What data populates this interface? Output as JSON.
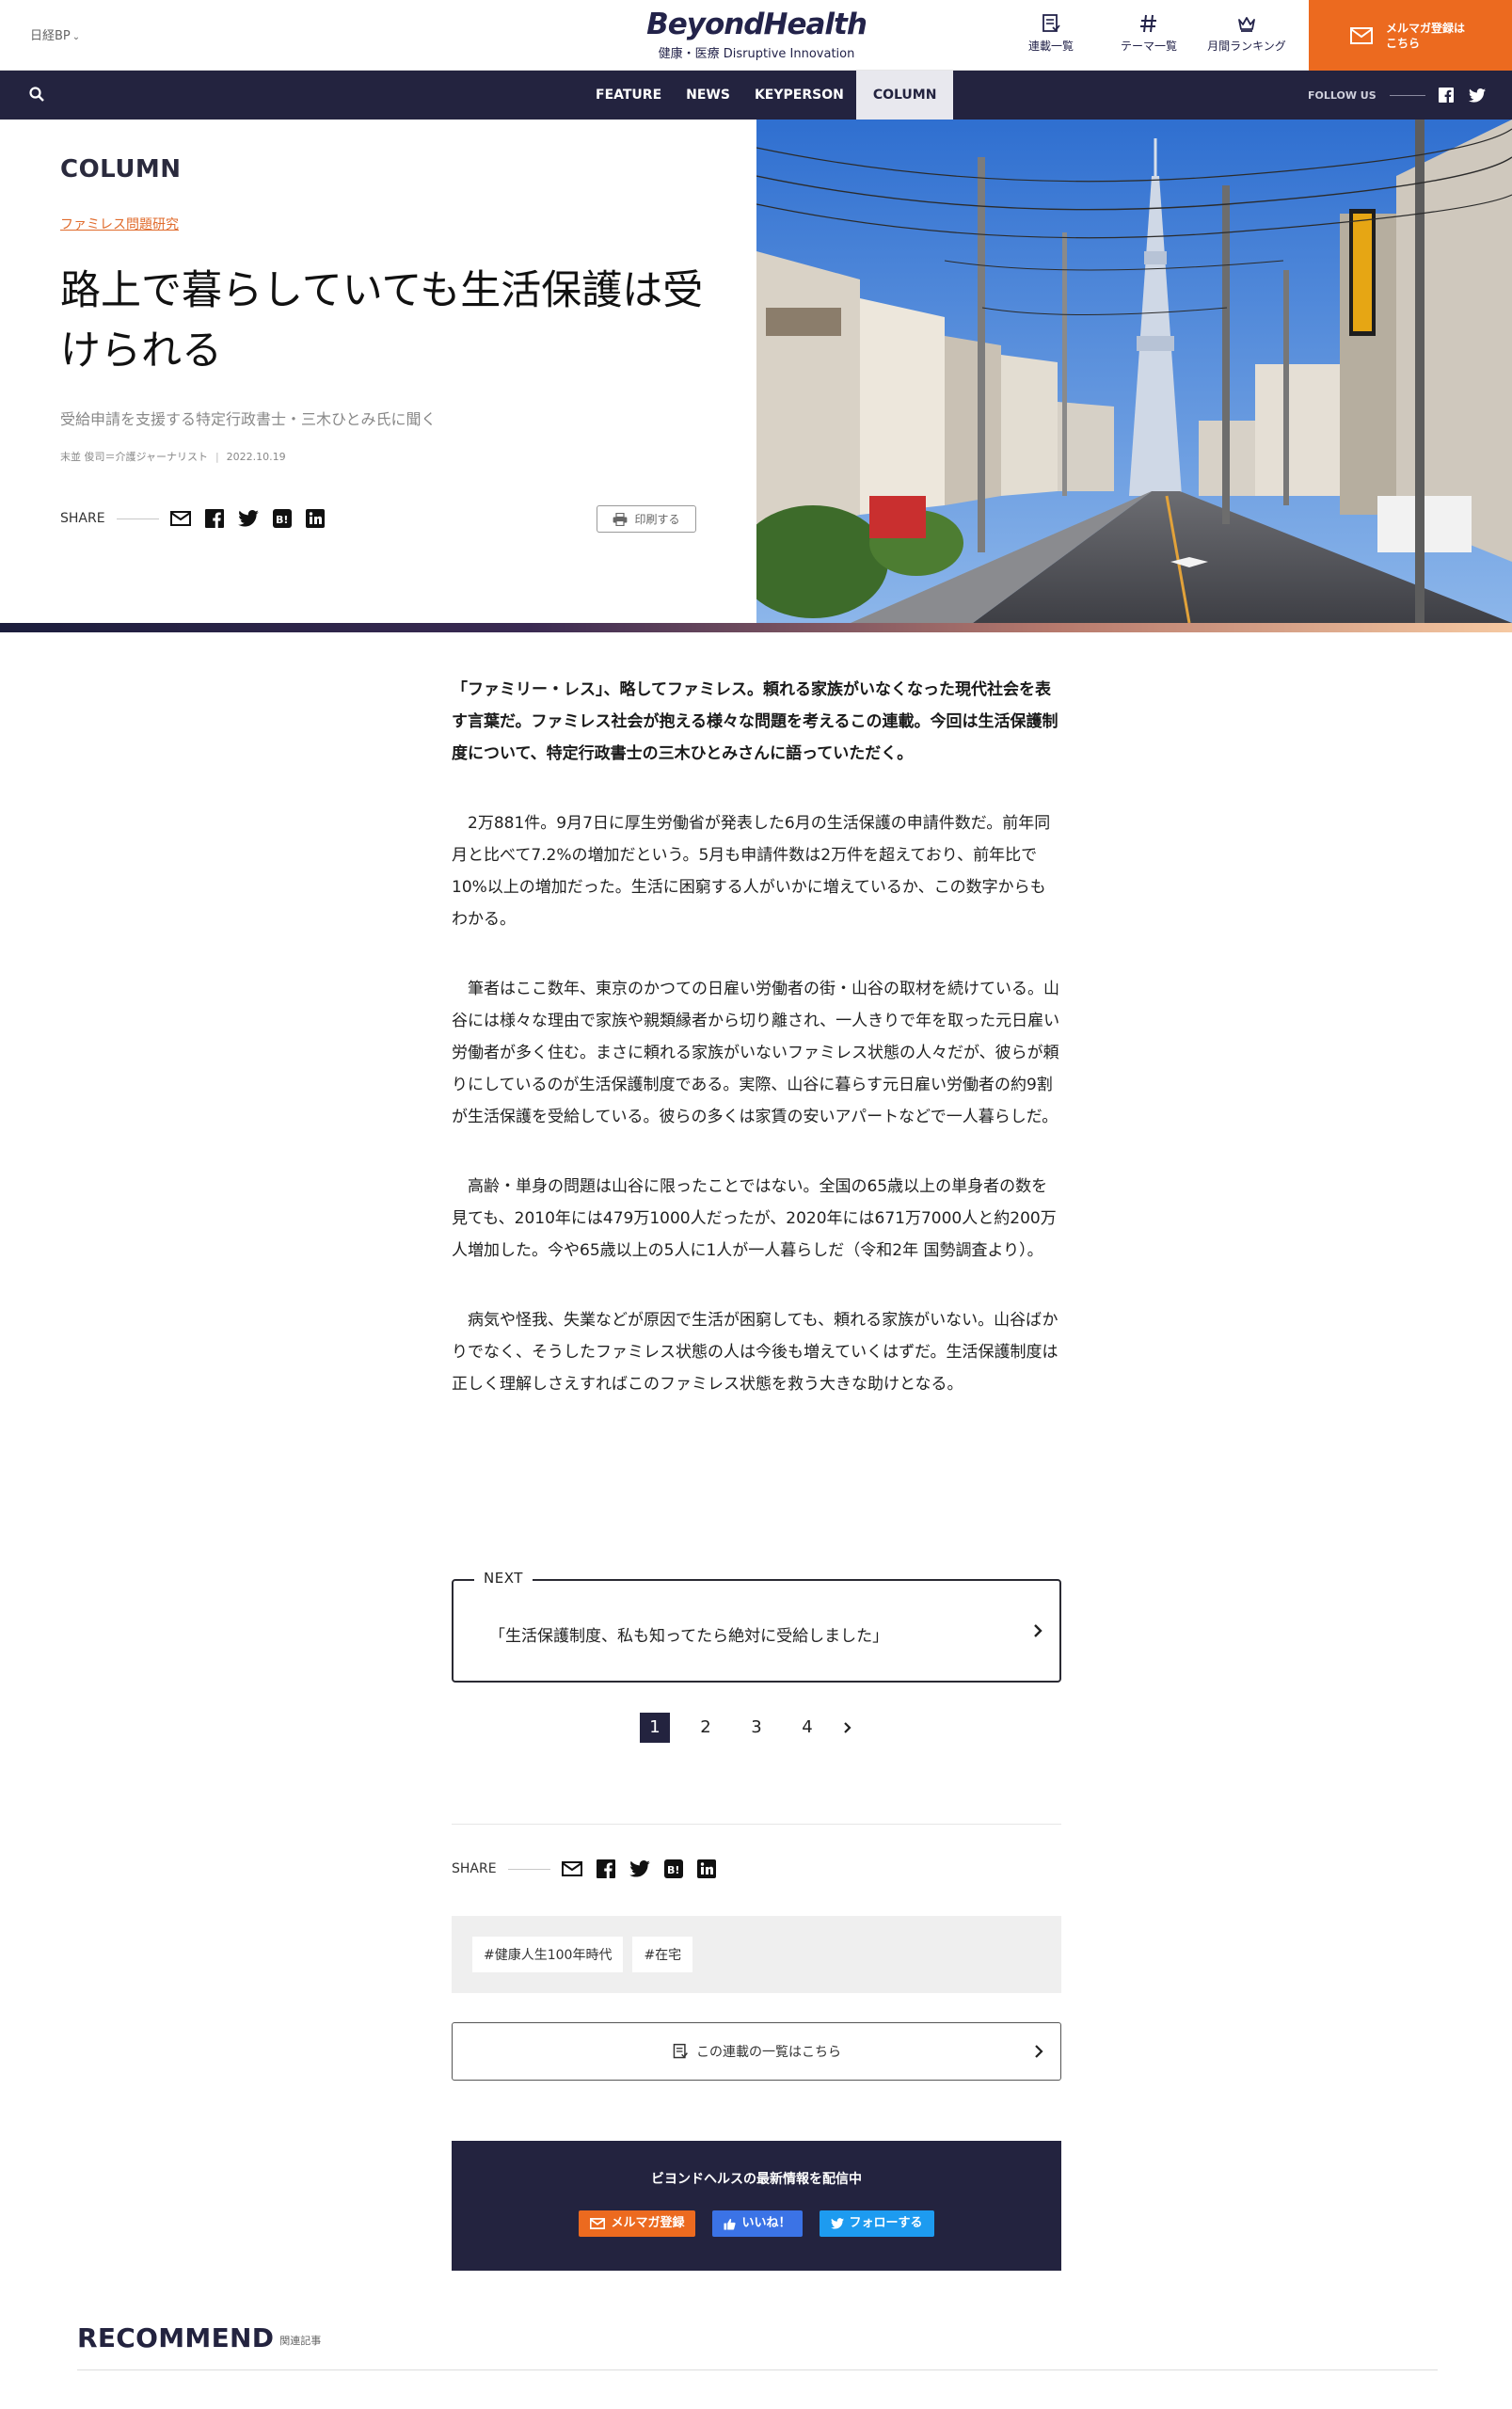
{
  "header": {
    "publisher": "日経BP",
    "brand_name": "BeyondHealth",
    "brand_tagline": "健康・医療 Disruptive Innovation",
    "tools": [
      {
        "label": "連載一覧",
        "icon": "list-icon"
      },
      {
        "label": "テーマ一覧",
        "icon": "hash-icon"
      },
      {
        "label": "月間ランキング",
        "icon": "crown-icon"
      }
    ],
    "mail_cta": "メルマガ登録は\nこちら"
  },
  "nav": {
    "items": [
      "FEATURE",
      "NEWS",
      "KEYPERSON",
      "COLUMN"
    ],
    "active": "COLUMN",
    "follow_label": "FOLLOW US"
  },
  "hero": {
    "section": "COLUMN",
    "series": "ファミレス問題研究",
    "title": "路上で暮らしていても生活保護は受けられる",
    "subtitle": "受給申請を支援する特定行政書士・三木ひとみ氏に聞く",
    "author": "末並 俊司＝介護ジャーナリスト",
    "date": "2022.10.19",
    "share_label": "SHARE",
    "print_label": "印刷する"
  },
  "article": {
    "lead": "「ファミリー・レス」、略してファミレス。頼れる家族がいなくなった現代社会を表す言葉だ。ファミレス社会が抱える様々な問題を考えるこの連載。今回は生活保護制度について、特定行政書士の三木ひとみさんに語っていただく。",
    "paragraphs": [
      "2万881件。9月7日に厚生労働省が発表した6月の生活保護の申請件数だ。前年同月と比べて7.2%の増加だという。5月も申請件数は2万件を超えており、前年比で10%以上の増加だった。生活に困窮する人がいかに増えているか、この数字からもわかる。",
      "筆者はここ数年、東京のかつての日雇い労働者の街・山谷の取材を続けている。山谷には様々な理由で家族や親類縁者から切り離され、一人きりで年を取った元日雇い労働者が多く住む。まさに頼れる家族がいないファミレス状態の人々だが、彼らが頼りにしているのが生活保護制度である。実際、山谷に暮らす元日雇い労働者の約9割が生活保護を受給している。彼らの多くは家賃の安いアパートなどで一人暮らしだ。",
      "高齢・単身の問題は山谷に限ったことではない。全国の65歳以上の単身者の数を見ても、2010年には479万1000人だったが、2020年には671万7000人と約200万人増加した。今や65歳以上の5人に1人が一人暮らしだ（令和2年 国勢調査より）。",
      "病気や怪我、失業などが原因で生活が困窮しても、頼れる家族がいない。山谷ばかりでなく、そうしたファミレス状態の人は今後も増えていくはずだ。生活保護制度は正しく理解しさえすればこのファミレス状態を救う大きな助けとなる。"
    ]
  },
  "next": {
    "label": "NEXT",
    "title": "「生活保護制度、私も知ってたら絶対に受給しました」"
  },
  "pagination": {
    "pages": [
      "1",
      "2",
      "3",
      "4"
    ],
    "current": "1"
  },
  "footer_share": {
    "label": "SHARE"
  },
  "tags": [
    "#健康人生100年時代",
    "#在宅"
  ],
  "series_list": {
    "label": "この連載の一覧はこちら"
  },
  "newsletter": {
    "heading": "ビヨンドヘルスの最新情報を配信中",
    "mail": "メルマガ登録",
    "like": "いいね！",
    "twitter": "フォローする"
  },
  "recommend": {
    "title": "RECOMMEND",
    "sub": "関連記事"
  },
  "colors": {
    "navy": "#23233f",
    "orange": "#ec6a1f",
    "accent_link": "#e06b2c"
  }
}
